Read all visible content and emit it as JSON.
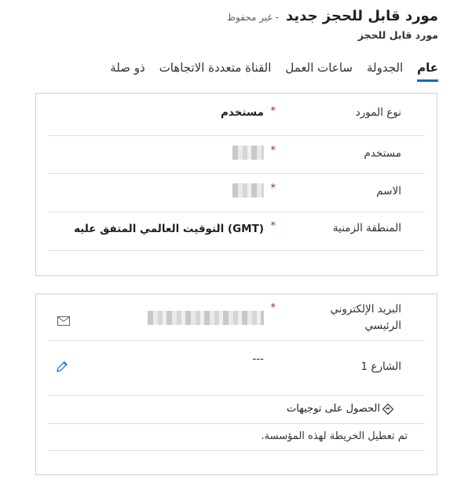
{
  "header": {
    "title": "مورد قابل للحجز جديد",
    "status": "- غير محفوظ",
    "subtitle": "مورد قابل للحجز"
  },
  "tabs": [
    {
      "label": "عام",
      "active": true
    },
    {
      "label": "الجدولة",
      "active": false
    },
    {
      "label": "ساعات العمل",
      "active": false
    },
    {
      "label": "القناة متعددة الاتجاهات",
      "active": false
    },
    {
      "label": "ذو صلة",
      "active": false
    }
  ],
  "general": {
    "resource_type": {
      "label": "نوع المورد",
      "required": "*",
      "value": "مستخدم"
    },
    "user": {
      "label": "مستخدم",
      "required": "*"
    },
    "name": {
      "label": "الاسم",
      "required": "*"
    },
    "time_zone": {
      "label": "المنطقة الزمنية",
      "required": "*",
      "value": "(GMT) التوقيت العالمي المتفق عليه"
    }
  },
  "contact": {
    "email": {
      "label": "البريد الإلكتروني الرئيسي",
      "required": "*"
    },
    "street1": {
      "label": "الشارع 1",
      "value": "---"
    },
    "directions": "الحصول على توجيهات",
    "map_disabled": "تم تعطيل الخريطة لهذه المؤسسة."
  },
  "icons": {
    "email": "email-icon",
    "edit": "pencil-icon",
    "directions": "directions-icon"
  },
  "colors": {
    "accent": "#0f6cbd",
    "required": "#a4262c"
  }
}
